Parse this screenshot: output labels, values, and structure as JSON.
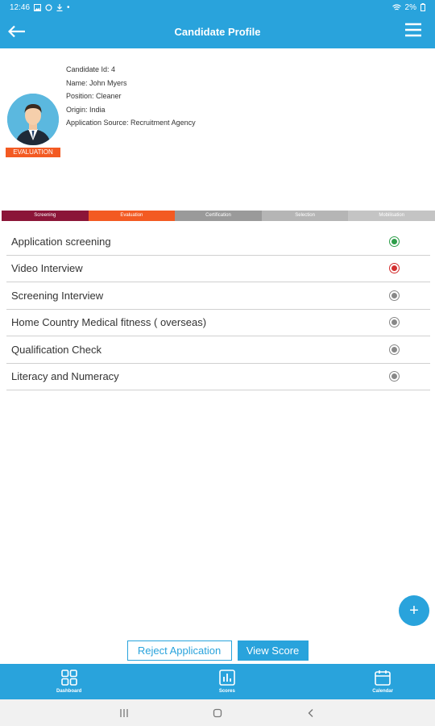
{
  "status_bar": {
    "time": "12:46",
    "battery": "2%"
  },
  "app_bar": {
    "title": "Candidate Profile"
  },
  "candidate": {
    "id_line": "Candidate Id: 4",
    "name_line": "Name: John Myers",
    "position_line": "Position: Cleaner",
    "origin_line": "Origin: India",
    "source_line": "Application Source: Recruitment Agency",
    "stage_badge": "EVALUATION"
  },
  "progress": {
    "stages": [
      {
        "label": "Screening",
        "color": "#8b1538"
      },
      {
        "label": "Evaluation",
        "color": "#f35a22"
      },
      {
        "label": "Certification",
        "color": "#9a9a9a"
      },
      {
        "label": "Selection",
        "color": "#b5b5b5"
      },
      {
        "label": "Mobilisation",
        "color": "#c4c4c4"
      }
    ]
  },
  "checklist": [
    {
      "label": "Application screening",
      "status": "done",
      "color": "#2e9e4a"
    },
    {
      "label": "Video Interview",
      "status": "failed",
      "color": "#d32f2f"
    },
    {
      "label": "Screening Interview",
      "status": "pending",
      "color": "#888888"
    },
    {
      "label": "Home Country Medical fitness ( overseas)",
      "status": "pending",
      "color": "#888888"
    },
    {
      "label": "Qualification Check",
      "status": "pending",
      "color": "#888888"
    },
    {
      "label": "Literacy and Numeracy",
      "status": "pending",
      "color": "#888888"
    }
  ],
  "fab": {
    "icon": "plus-icon",
    "label": "+"
  },
  "actions": {
    "reject_label": "Reject Application",
    "score_label": "View Score"
  },
  "bottom_nav": {
    "items": [
      {
        "label": "Dashboard",
        "icon": "grid-icon"
      },
      {
        "label": "Scores",
        "icon": "bar-chart-icon"
      },
      {
        "label": "Calendar",
        "icon": "calendar-icon"
      }
    ]
  },
  "colors": {
    "primary": "#29a3dc",
    "accent": "#f35a22"
  }
}
